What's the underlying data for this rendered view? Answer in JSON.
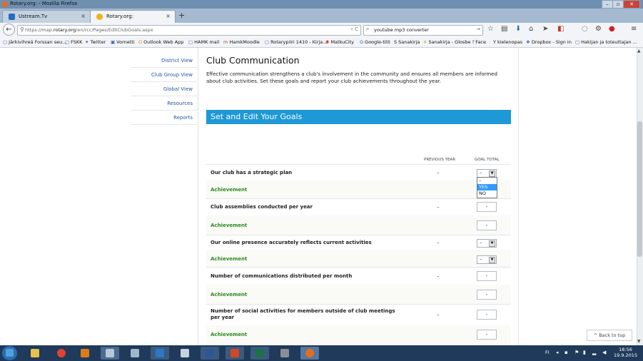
{
  "window": {
    "title": "Rotary.org: - Mozilla Firefox",
    "minimize": "–",
    "maximize": "▫",
    "close": "✕"
  },
  "tabs": [
    {
      "label": "Ustream.Tv",
      "close": "×"
    },
    {
      "label": "Rotary.org:",
      "close": "×"
    }
  ],
  "newtab": "+",
  "nav": {
    "back": "←",
    "url_prefix": "https://map.",
    "url_domain": "rotary.org",
    "url_path": "/en/rcc/Pages/EditClubGoals.aspx",
    "reload": "▿ C",
    "search_value": "youtube mp3 converter",
    "search_go": "→",
    "toolbar_icons": [
      "star-icon",
      "clipboard-icon",
      "download-icon",
      "home-icon",
      "send-icon",
      "pocket-icon",
      "chat-icon",
      "gear-icon",
      "abp-icon",
      "menu-icon"
    ]
  },
  "bookmarks": [
    "Järkivihreä Forssan seu...",
    "FSKK",
    "Twitter",
    "Vornetti",
    "Outlook Web App",
    "HAMK mail",
    "HamkMoodle",
    "Rotarypiiri 1410 - Kirja...",
    "MatkuCity",
    "Google-tilit",
    "Sanakirja",
    "Sanakirja - Glosbe",
    "Face",
    "kielenopas",
    "Dropbox - Sign in",
    "Hakijan ja toteuttajan ..."
  ],
  "sidebar": {
    "items": [
      "District View",
      "Club Group View",
      "Global View",
      "Resources",
      "Reports"
    ]
  },
  "main": {
    "title": "Club Communication",
    "intro": "Effective communication strengthens a club's involvement in the community and ensures all members are informed about club activities. Set these goals and report your club achievements throughout the year.",
    "goals_header": "Set and Edit Your Goals",
    "col_prev": "PREVIOUS YEAR",
    "col_goal": "GOAL TOTAL",
    "achievement_label": "Achievement",
    "rows": [
      {
        "label": "Our club has a strategic plan",
        "prev": "–",
        "goal": "–",
        "achv": "–"
      },
      {
        "label": "Club assemblies conducted per year",
        "prev": "–",
        "goal": "-",
        "achv": "-"
      },
      {
        "label": "Our online presence accurately reflects current activities",
        "prev": "–",
        "goal": "–",
        "achv": "–"
      },
      {
        "label": "Number of communications distributed per month",
        "prev": "–",
        "goal": "-",
        "achv": "-"
      },
      {
        "label": "Number of social activities for members outside of club meetings per year",
        "prev": "–",
        "goal": "-",
        "achv": "-"
      }
    ],
    "dropdown_options": [
      "–",
      "YES",
      "NO"
    ],
    "back_to_top": "^ Back to top"
  },
  "taskbar": {
    "apps": [
      "explorer",
      "chrome",
      "media-player",
      "network",
      "notepad",
      "outlook",
      "files",
      "word",
      "powerpoint",
      "excel",
      "tools",
      "firefox"
    ],
    "lang": "FI",
    "time": "18:56",
    "date": "19.9.2015"
  },
  "colors": {
    "accent": "#1e98d6",
    "achievement": "#2e8b1f",
    "link": "#2457a7"
  }
}
